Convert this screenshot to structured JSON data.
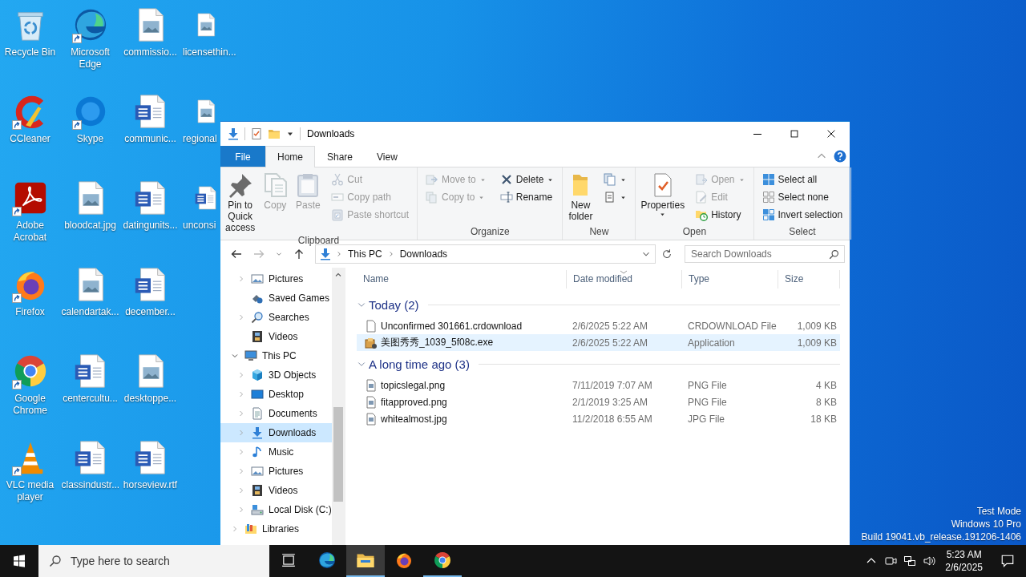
{
  "desktop": {
    "columns": [
      [
        {
          "label": "Recycle Bin",
          "kind": "recycle-bin",
          "shortcut": false
        },
        {
          "label": "CCleaner",
          "kind": "ccleaner",
          "shortcut": true
        },
        {
          "label": "Adobe Acrobat",
          "kind": "acrobat",
          "shortcut": true
        },
        {
          "label": "Firefox",
          "kind": "firefox",
          "shortcut": true
        },
        {
          "label": "Google Chrome",
          "kind": "chrome",
          "shortcut": true
        },
        {
          "label": "VLC media player",
          "kind": "vlc",
          "shortcut": true
        }
      ],
      [
        {
          "label": "Microsoft Edge",
          "kind": "edge",
          "shortcut": true
        },
        {
          "label": "Skype",
          "kind": "skype",
          "shortcut": true
        },
        {
          "label": "bloodcat.jpg",
          "kind": "image-file",
          "shortcut": false
        },
        {
          "label": "calendartak...",
          "kind": "image-file",
          "shortcut": false
        },
        {
          "label": "centercultu...",
          "kind": "word-file",
          "shortcut": false
        },
        {
          "label": "classindustr...",
          "kind": "word-file",
          "shortcut": false
        }
      ],
      [
        {
          "label": "commissio...",
          "kind": "image-file",
          "shortcut": false
        },
        {
          "label": "communic...",
          "kind": "word-file",
          "shortcut": false
        },
        {
          "label": "datingunits...",
          "kind": "word-file",
          "shortcut": false
        },
        {
          "label": "december...",
          "kind": "word-file",
          "shortcut": false
        },
        {
          "label": "desktoppe...",
          "kind": "image-file",
          "shortcut": false
        },
        {
          "label": "horseview.rtf",
          "kind": "word-file",
          "shortcut": false
        }
      ],
      [
        {
          "label": "licensethin...",
          "kind": "image-file",
          "shortcut": false
        },
        {
          "label": "regional",
          "kind": "image-file",
          "shortcut": false
        },
        {
          "label": "unconsi",
          "kind": "word-file",
          "shortcut": false
        }
      ]
    ],
    "system_text": [
      "Test Mode",
      "Windows 10 Pro",
      "Build 19041.vb_release.191206-1406"
    ]
  },
  "explorer": {
    "title": "Downloads",
    "tabs": [
      {
        "label": "File",
        "kind": "menu",
        "selected": false
      },
      {
        "label": "Home",
        "kind": "tab",
        "selected": true
      },
      {
        "label": "Share",
        "kind": "tab",
        "selected": false
      },
      {
        "label": "View",
        "kind": "tab",
        "selected": false
      }
    ],
    "ribbon": [
      {
        "label": "Clipboard",
        "items": [
          {
            "kind": "large",
            "label": "Pin to Quick access",
            "disabled": false,
            "dropdown": false
          },
          {
            "kind": "large",
            "label": "Copy",
            "disabled": true,
            "dropdown": false
          },
          {
            "kind": "large",
            "label": "Paste",
            "disabled": true,
            "dropdown": false
          },
          {
            "kind": "stack",
            "buttons": [
              {
                "label": "Cut",
                "disabled": true,
                "dropdown": false
              },
              {
                "label": "Copy path",
                "disabled": true,
                "dropdown": false
              },
              {
                "label": "Paste shortcut",
                "disabled": true,
                "dropdown": false
              }
            ]
          }
        ]
      },
      {
        "label": "Organize",
        "items": [
          {
            "kind": "stack",
            "buttons": [
              {
                "label": "Move to",
                "disabled": true,
                "dropdown": true
              },
              {
                "label": "Copy to",
                "disabled": true,
                "dropdown": true
              }
            ]
          },
          {
            "kind": "stack",
            "buttons": [
              {
                "label": "Delete",
                "disabled": false,
                "dropdown": true
              },
              {
                "label": "Rename",
                "disabled": false,
                "dropdown": false
              }
            ]
          }
        ]
      },
      {
        "label": "New",
        "items": [
          {
            "kind": "large",
            "label": "New folder",
            "disabled": false,
            "dropdown": false
          },
          {
            "kind": "stack",
            "buttons": [
              {
                "disabled": false,
                "dropdown": true
              },
              {
                "disabled": false,
                "dropdown": true
              }
            ]
          }
        ]
      },
      {
        "label": "Open",
        "items": [
          {
            "kind": "large",
            "label": "Properties",
            "disabled": false,
            "dropdown": true
          },
          {
            "kind": "stack",
            "buttons": [
              {
                "label": "Open",
                "disabled": true,
                "dropdown": true
              },
              {
                "label": "Edit",
                "disabled": true,
                "dropdown": false
              },
              {
                "label": "History",
                "disabled": false,
                "dropdown": false
              }
            ]
          }
        ]
      },
      {
        "label": "Select",
        "items": [
          {
            "kind": "stack",
            "buttons": [
              {
                "label": "Select all",
                "disabled": false,
                "dropdown": false
              },
              {
                "label": "Select none",
                "disabled": false,
                "dropdown": false
              },
              {
                "label": "Invert selection",
                "disabled": false,
                "dropdown": false
              }
            ]
          }
        ]
      }
    ],
    "address": {
      "path": [
        "This PC",
        "Downloads"
      ]
    },
    "search": {
      "placeholder": "Search Downloads"
    },
    "nav_pane": {
      "items": [
        {
          "children": [
            {
              "label": "Pictures",
              "kind": "pictures",
              "expanded": false,
              "selected": false
            },
            {
              "label": "Saved Games",
              "kind": "saved-games",
              "selected": false
            },
            {
              "label": "Searches",
              "kind": "searches",
              "expanded": false,
              "selected": false
            },
            {
              "label": "Videos",
              "kind": "videos",
              "selected": false
            }
          ]
        },
        {
          "label": "This PC",
          "kind": "this-pc",
          "expanded": true,
          "selected": false,
          "children": [
            {
              "label": "3D Objects",
              "kind": "objects",
              "expanded": false,
              "selected": false
            },
            {
              "label": "Desktop",
              "kind": "desktop",
              "expanded": false,
              "selected": false
            },
            {
              "label": "Documents",
              "kind": "documents",
              "expanded": false,
              "selected": false
            },
            {
              "label": "Downloads",
              "kind": "downloads",
              "expanded": false,
              "selected": true
            },
            {
              "label": "Music",
              "kind": "music",
              "expanded": false,
              "selected": false
            },
            {
              "label": "Pictures",
              "kind": "pictures",
              "expanded": false,
              "selected": false
            },
            {
              "label": "Videos",
              "kind": "videos",
              "expanded": false,
              "selected": false
            },
            {
              "label": "Local Disk (C:)",
              "kind": "local-disk",
              "expanded": false,
              "selected": false
            }
          ]
        },
        {
          "label": "Libraries",
          "kind": "libraries",
          "expanded": false,
          "selected": false
        }
      ]
    },
    "columns": [
      {
        "label": "Name",
        "sorted": false
      },
      {
        "label": "Date modified",
        "sorted": true
      },
      {
        "label": "Type",
        "sorted": false
      },
      {
        "label": "Size",
        "sorted": false
      }
    ],
    "groups": [
      {
        "label": "Today (2)",
        "expanded": true,
        "files": [
          {
            "name": "Unconfirmed 301661.crdownload",
            "date": "2/6/2025 5:22 AM",
            "type": "CRDOWNLOAD File",
            "size": "1,009 KB",
            "kind": "blank",
            "selected": false
          },
          {
            "name": "美图秀秀_1039_5f08c.exe",
            "date": "2/6/2025 5:22 AM",
            "type": "Application",
            "size": "1,009 KB",
            "kind": "exe",
            "selected": true
          }
        ]
      },
      {
        "label": "A long time ago (3)",
        "expanded": true,
        "files": [
          {
            "name": "topicslegal.png",
            "date": "7/11/2019 7:07 AM",
            "type": "PNG File",
            "size": "4 KB",
            "kind": "image",
            "selected": false
          },
          {
            "name": "fitapproved.png",
            "date": "2/1/2019 3:25 AM",
            "type": "PNG File",
            "size": "8 KB",
            "kind": "image",
            "selected": false
          },
          {
            "name": "whitealmost.jpg",
            "date": "11/2/2018 6:55 AM",
            "type": "JPG File",
            "size": "18 KB",
            "kind": "image",
            "selected": false
          }
        ]
      }
    ]
  },
  "taskbar": {
    "search": {
      "placeholder": "Type here to search"
    },
    "apps": [
      {
        "kind": "task-view",
        "running": false,
        "selected": false
      },
      {
        "kind": "edge",
        "running": false,
        "selected": false
      },
      {
        "kind": "explorer",
        "running": true,
        "selected": true
      },
      {
        "kind": "firefox",
        "running": false,
        "selected": false
      },
      {
        "kind": "chrome",
        "running": true,
        "selected": false
      }
    ],
    "tray": {
      "time": "5:23 AM",
      "date": "2/6/2025"
    }
  }
}
